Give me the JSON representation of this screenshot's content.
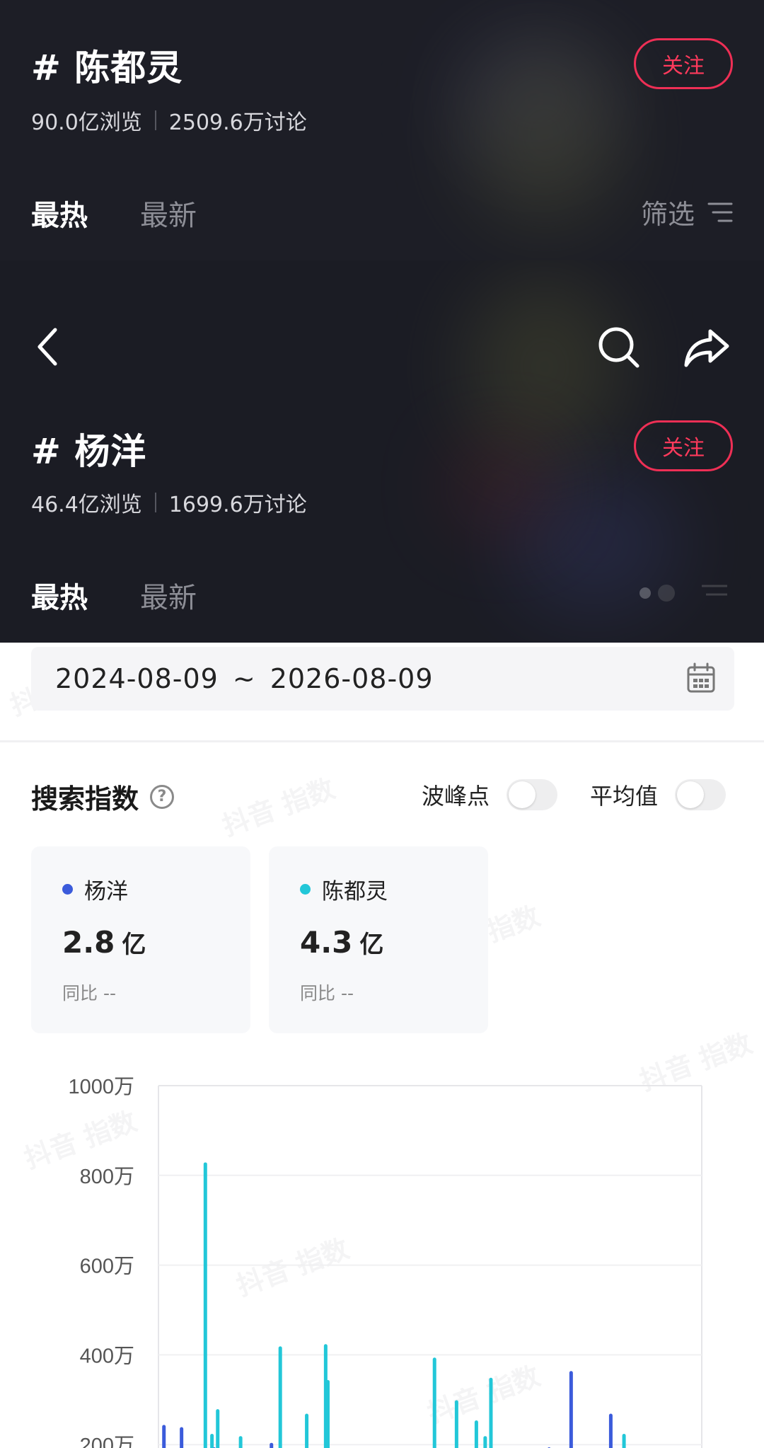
{
  "topics": [
    {
      "title": "# 陈都灵",
      "views": "90.0亿浏览",
      "discussions": "2509.6万讨论",
      "follow_label": "关注",
      "tabs": [
        "最热",
        "最新"
      ],
      "filter_label": "筛选"
    },
    {
      "title": "# 杨洋",
      "views": "46.4亿浏览",
      "discussions": "1699.6万讨论",
      "follow_label": "关注",
      "tabs": [
        "最热",
        "最新"
      ]
    }
  ],
  "date_range": {
    "start": "2024-08-09",
    "separator": "~",
    "end": "2026-08-09"
  },
  "search_index": {
    "title": "搜索指数",
    "toggles": [
      {
        "label": "波峰点",
        "on": false
      },
      {
        "label": "平均值",
        "on": false
      }
    ],
    "cards": [
      {
        "name": "杨洋",
        "value": "2.8",
        "unit": "亿",
        "yoy": "同比 --",
        "color": "#3b5bdb"
      },
      {
        "name": "陈都灵",
        "value": "4.3",
        "unit": "亿",
        "yoy": "同比 --",
        "color": "#22c7d8"
      }
    ]
  },
  "watermark_text": "抖音 指数",
  "chart_data": {
    "type": "bar",
    "y_tick_labels": [
      "1000万",
      "800万",
      "600万",
      "400万",
      "200万"
    ],
    "y_ticks": [
      1000,
      800,
      600,
      400,
      200
    ],
    "ylim": [
      0,
      1000
    ],
    "xlim": [
      0,
      122
    ],
    "grid": true,
    "series": [
      {
        "name": "杨洋",
        "color": "#3b5bdb",
        "points": [
          [
            0.6,
            240
          ],
          [
            4.6,
            235
          ],
          [
            12,
            190
          ],
          [
            25,
            200
          ],
          [
            43,
            180
          ],
          [
            75,
            160
          ],
          [
            88,
            190
          ],
          [
            93,
            360
          ],
          [
            102,
            265
          ],
          [
            104,
            150
          ]
        ]
      },
      {
        "name": "陈都灵",
        "color": "#22c7d8",
        "points": [
          [
            10,
            825
          ],
          [
            11.5,
            220
          ],
          [
            12.8,
            275
          ],
          [
            18,
            215
          ],
          [
            27,
            415
          ],
          [
            33,
            265
          ],
          [
            37.3,
            420
          ],
          [
            37.8,
            340
          ],
          [
            62,
            390
          ],
          [
            67,
            295
          ],
          [
            71.5,
            250
          ],
          [
            73.5,
            215
          ],
          [
            74.8,
            345
          ],
          [
            105,
            220
          ]
        ]
      }
    ]
  }
}
